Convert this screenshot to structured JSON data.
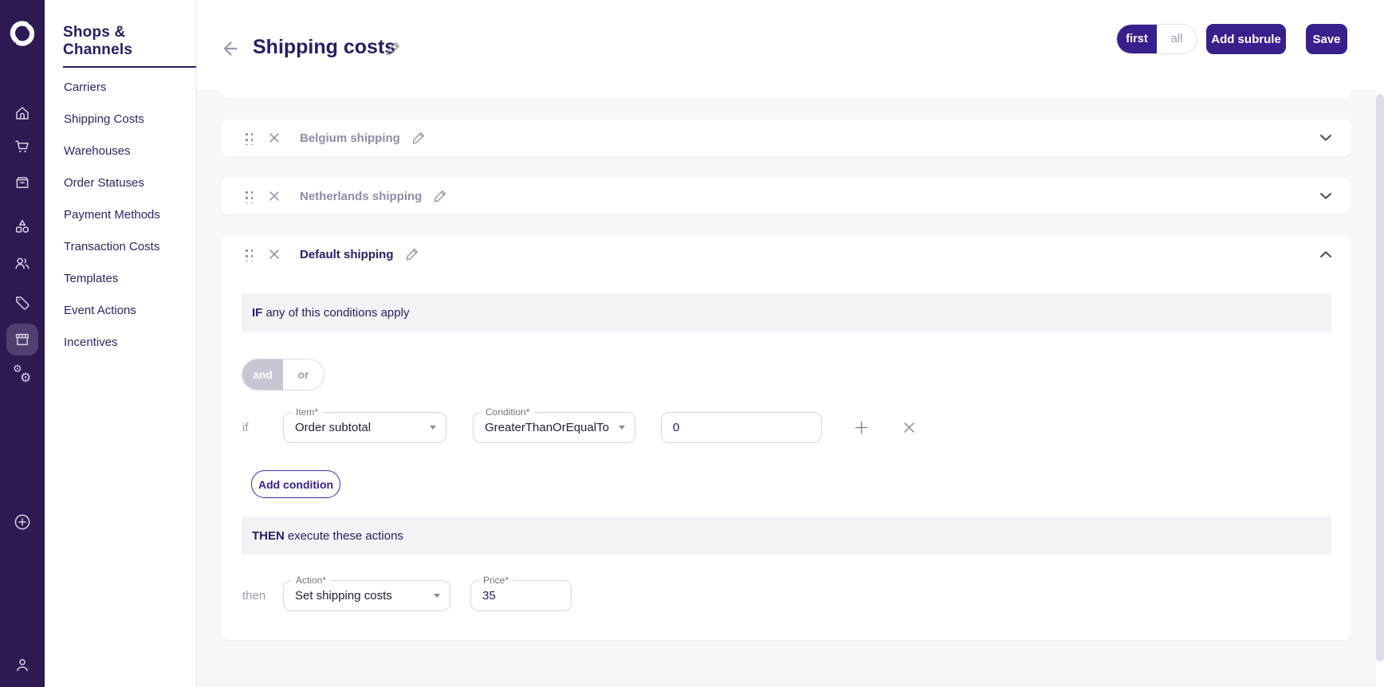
{
  "rail": {
    "icons": [
      "home",
      "shopping-cart",
      "orders-box",
      "catalog-shapes",
      "customers",
      "tags",
      "store",
      "settings-gears",
      "add-new",
      "profile"
    ],
    "active_icon": "store"
  },
  "sidebar": {
    "title": "Shops & Channels",
    "items": [
      {
        "label": "Carriers"
      },
      {
        "label": "Shipping Costs"
      },
      {
        "label": "Warehouses"
      },
      {
        "label": "Order Statuses"
      },
      {
        "label": "Payment Methods"
      },
      {
        "label": "Transaction Costs"
      },
      {
        "label": "Templates"
      },
      {
        "label": "Event Actions"
      },
      {
        "label": "Incentives"
      }
    ]
  },
  "header": {
    "title": "Shipping costs",
    "mode_toggle": {
      "options": [
        "first",
        "all"
      ],
      "selected": "first"
    },
    "buttons": {
      "add_subrule": "Add subrule",
      "save": "Save"
    }
  },
  "rules": [
    {
      "title": "Belgium shipping",
      "state": "collapsed"
    },
    {
      "title": "Netherlands shipping",
      "state": "collapsed"
    },
    {
      "title": "Default shipping",
      "state": "expanded",
      "if_bar": {
        "keyword": "IF",
        "text": "any of this conditions apply"
      },
      "operator_toggle": {
        "options": [
          "and",
          "or"
        ],
        "selected": "and"
      },
      "conditions": [
        {
          "prefix": "if",
          "item": {
            "label": "Item*",
            "value": "Order subtotal"
          },
          "condition": {
            "label": "Condition*",
            "value": "GreaterThanOrEqualTo"
          },
          "value": "0"
        }
      ],
      "add_condition_label": "Add condition",
      "then_bar": {
        "keyword": "THEN",
        "text": "execute these actions"
      },
      "actions": [
        {
          "prefix": "then",
          "action": {
            "label": "Action*",
            "value": "Set shipping costs"
          },
          "price": {
            "label": "Price*",
            "value": "35"
          }
        }
      ]
    }
  ],
  "colors": {
    "primary": "#38208c",
    "rail_bg": "#2d1a53",
    "heading": "#262060",
    "muted_text": "#9c9aac",
    "collapsed_title": "#8f8ca6",
    "section_bar_bg": "#f2f3f6",
    "content_bg": "#f6f7f9",
    "field_border": "#d7d4e6",
    "scrollbar_thumb": "#dfdcec"
  }
}
